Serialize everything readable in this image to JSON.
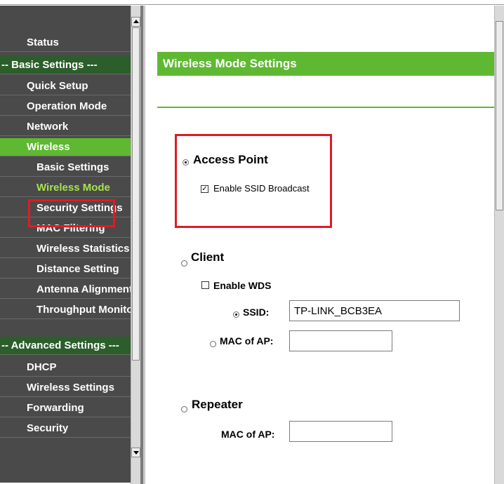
{
  "sidebar": {
    "items": [
      {
        "label": "Status"
      },
      {
        "label": "-- Basic Settings ---"
      },
      {
        "label": "Quick Setup"
      },
      {
        "label": "Operation Mode"
      },
      {
        "label": "Network"
      },
      {
        "label": "Wireless"
      },
      {
        "label": "Basic Settings"
      },
      {
        "label": "Wireless Mode"
      },
      {
        "label": "Security Settings"
      },
      {
        "label": "MAC Filtering"
      },
      {
        "label": "Wireless Statistics"
      },
      {
        "label": "Distance Setting"
      },
      {
        "label": "Antenna Alignment"
      },
      {
        "label": "Throughput Monitor"
      },
      {
        "label": "-- Advanced Settings ---"
      },
      {
        "label": "DHCP"
      },
      {
        "label": "Wireless Settings"
      },
      {
        "label": "Forwarding"
      },
      {
        "label": "Security"
      }
    ]
  },
  "main": {
    "title": "Wireless Mode Settings",
    "access_point": {
      "label": "Access Point",
      "selected": true,
      "ssid_broadcast": {
        "label": "Enable SSID Broadcast",
        "checked": true
      }
    },
    "client": {
      "label": "Client",
      "selected": false,
      "wds": {
        "label": "Enable WDS",
        "checked": false
      },
      "ssid_label": "SSID:",
      "ssid_value": "TP-LINK_BCB3EA",
      "mac_label": "MAC of AP:",
      "mac_value": ""
    },
    "repeater": {
      "label": "Repeater",
      "selected": false,
      "mac_label": "MAC of AP:",
      "mac_value": ""
    }
  },
  "colors": {
    "brand_green": "#5fb832",
    "sidebar_bg": "#4a4a4a",
    "highlight_red": "#e01b24"
  }
}
